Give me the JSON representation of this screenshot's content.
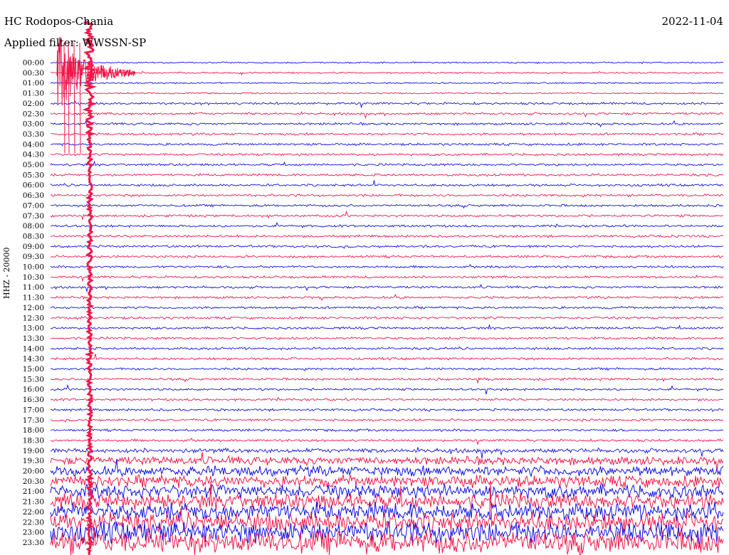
{
  "header": {
    "station": "HC Rodopos-Chania",
    "filter": "Applied filter: WWSSN-SP",
    "date": "2022-11-04",
    "channel": "HHZ - 20000"
  },
  "colors": {
    "trace_a": "#1010e6",
    "trace_b": "#f0174a"
  },
  "chart_data": {
    "type": "line",
    "ylabel": "HHZ - 20000",
    "rows": [
      "00:00",
      "00:30",
      "01:00",
      "01:30",
      "02:00",
      "02:30",
      "03:00",
      "03:30",
      "04:00",
      "04:30",
      "05:00",
      "05:30",
      "06:00",
      "06:30",
      "07:00",
      "07:30",
      "08:00",
      "08:30",
      "09:00",
      "09:30",
      "10:00",
      "10:30",
      "11:00",
      "11:30",
      "12:00",
      "12:30",
      "13:00",
      "13:30",
      "14:00",
      "14:30",
      "15:00",
      "15:30",
      "16:00",
      "16:30",
      "17:00",
      "17:30",
      "18:00",
      "18:30",
      "19:00",
      "19:30",
      "20:00",
      "20:30",
      "21:00",
      "21:30",
      "22:00",
      "22:30",
      "23:00",
      "23:30"
    ],
    "series": [
      {
        "color_key": "trace_a",
        "row_parity": "even"
      },
      {
        "color_key": "trace_b",
        "row_parity": "odd"
      }
    ],
    "grid": false
  }
}
